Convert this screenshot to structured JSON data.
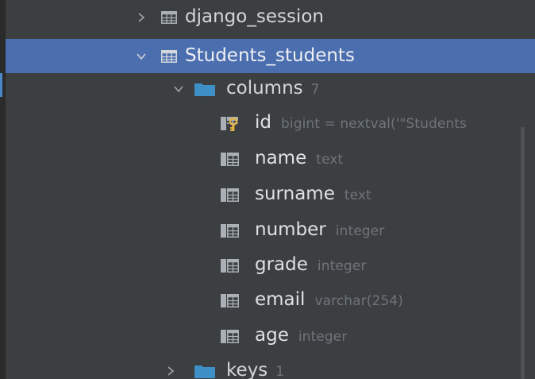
{
  "tree": {
    "tables": [
      {
        "name": "django_session",
        "expanded": false
      },
      {
        "name": "Students_students",
        "expanded": true,
        "selected": true
      }
    ],
    "columns_group": {
      "label": "columns",
      "count": "7",
      "expanded": true
    },
    "columns": [
      {
        "name": "id",
        "type": "bigint = nextval('\"Students",
        "icon": "primary-key-column-icon"
      },
      {
        "name": "name",
        "type": "text",
        "icon": "not-null-column-icon"
      },
      {
        "name": "surname",
        "type": "text",
        "icon": "not-null-column-icon"
      },
      {
        "name": "number",
        "type": "integer",
        "icon": "not-null-column-icon"
      },
      {
        "name": "grade",
        "type": "integer",
        "icon": "not-null-column-icon"
      },
      {
        "name": "email",
        "type": "varchar(254)",
        "icon": "column-icon"
      },
      {
        "name": "age",
        "type": "integer",
        "icon": "column-icon"
      }
    ],
    "keys_group": {
      "label": "keys",
      "count": "1",
      "expanded": false
    }
  },
  "colors": {
    "background": "#3c3f41",
    "selection": "#4b6eaf",
    "folder": "#3d8fc6",
    "key": "#e6b43c",
    "muted_text": "#6f7479"
  }
}
